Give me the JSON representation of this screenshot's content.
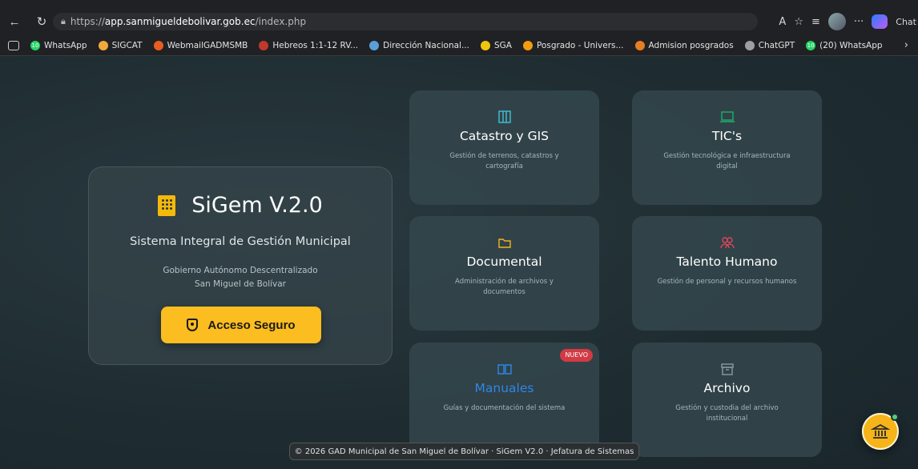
{
  "browser": {
    "url_prefix": "https://",
    "url_host": "app.sanmigueldebolivar.gob.ec",
    "url_path": "/index.php",
    "right_label": "Chat",
    "bookmarks": [
      {
        "label": "WhatsApp",
        "icon": "whatsapp-icon",
        "color": "#25d366",
        "badge": "10"
      },
      {
        "label": "SIGCAT",
        "icon": "sigcat-icon",
        "color": "#f2a93b",
        "badge": ""
      },
      {
        "label": "WebmailGADMSMB",
        "icon": "webmail-icon",
        "color": "#e85d1f",
        "badge": ""
      },
      {
        "label": "Hebreos 1:1-12 RV...",
        "icon": "bible-icon",
        "color": "#c0392b",
        "badge": ""
      },
      {
        "label": "Dirección Nacional...",
        "icon": "direccion-icon",
        "color": "#5aa0d8",
        "badge": ""
      },
      {
        "label": "SGA",
        "icon": "sga-icon",
        "color": "#f1c40f",
        "badge": ""
      },
      {
        "label": "Posgrado - Univers...",
        "icon": "posgrado-icon",
        "color": "#f39c12",
        "badge": ""
      },
      {
        "label": "Admision posgrados",
        "icon": "admision-icon",
        "color": "#e67e22",
        "badge": ""
      },
      {
        "label": "ChatGPT",
        "icon": "chatgpt-icon",
        "color": "#9aa0a6",
        "badge": ""
      },
      {
        "label": "(20) WhatsApp",
        "icon": "whatsapp-icon",
        "color": "#25d366",
        "badge": "10"
      }
    ]
  },
  "hero": {
    "title": "SiGem V.2.0",
    "subtitle": "Sistema Integral de Gestión Municipal",
    "org_line1": "Gobierno Autónomo Descentralizado",
    "org_line2": "San Miguel de Bolívar",
    "cta_label": "Acceso Seguro"
  },
  "cards": [
    {
      "key": "catastro",
      "title": "Catastro y GIS",
      "desc": "Gestión de terrenos, catastros y cartografía",
      "icon": "map-icon",
      "color": "#3ec3d8"
    },
    {
      "key": "tics",
      "title": "TIC's",
      "desc": "Gestión tecnológica e infraestructura digital",
      "icon": "laptop-icon",
      "color": "#1fae6a"
    },
    {
      "key": "documental",
      "title": "Documental",
      "desc": "Administración de archivos y documentos",
      "icon": "folder-icon",
      "color": "#f2b51c"
    },
    {
      "key": "talento",
      "title": "Talento Humano",
      "desc": "Gestión de personal y recursos humanos",
      "icon": "users-icon",
      "color": "#e0455a"
    },
    {
      "key": "manuales",
      "title": "Manuales",
      "desc": "Guías y documentación del sistema",
      "icon": "book-icon",
      "color": "#2f86e6",
      "badge": "NUEVO"
    },
    {
      "key": "archivo",
      "title": "Archivo",
      "desc": "Gestión y custodia del archivo institucional",
      "icon": "archive-icon",
      "color": "#8c9aa0"
    }
  ],
  "footer": {
    "text": "© 2026 GAD Municipal de San Miguel de Bolívar · SiGem V2.0 · Jefatura de Sistemas"
  }
}
